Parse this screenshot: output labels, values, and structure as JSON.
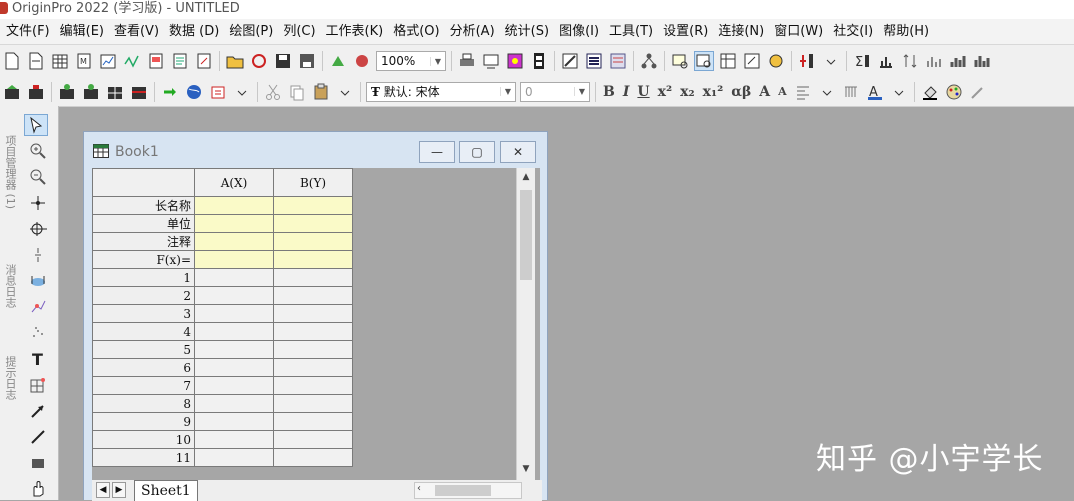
{
  "window": {
    "title": "OriginPro 2022 (学习版) - UNTITLED"
  },
  "menu": [
    "文件(F)",
    "编辑(E)",
    "查看(V)",
    "数据 (D)",
    "绘图(P)",
    "列(C)",
    "工作表(K)",
    "格式(O)",
    "分析(A)",
    "统计(S)",
    "图像(I)",
    "工具(T)",
    "设置(R)",
    "连接(N)",
    "窗口(W)",
    "社交(I)",
    "帮助(H)"
  ],
  "toolbar1": {
    "zoom_value": "100%"
  },
  "toolbar2": {
    "font_value": "默认: 宋体",
    "size_value": "0",
    "bold_label": "B",
    "italic_label": "I",
    "underline_label": "U",
    "super_label": "x²",
    "sub_label": "x₂",
    "supsub_label": "x₁²",
    "greek_label": "αβ",
    "font_up_label": "A",
    "font_down_label": "A"
  },
  "left_panel": {
    "tab1": "项目管理器 (1)",
    "tab2": "消息日志",
    "tab3": "提示日志"
  },
  "workbook": {
    "title": "Book1",
    "columns": [
      "A(X)",
      "B(Y)"
    ],
    "meta_rows": [
      "长名称",
      "单位",
      "注释",
      "F(x)="
    ],
    "rows": [
      "1",
      "2",
      "3",
      "4",
      "5",
      "6",
      "7",
      "8",
      "9",
      "10",
      "11"
    ],
    "sheet_tab": "Sheet1"
  },
  "watermark": "知乎 @小宇学长",
  "colors": {
    "meta_fill": "#fafac8",
    "workspace": "#a6a6a6",
    "window_frame": "#d7e4f2"
  }
}
